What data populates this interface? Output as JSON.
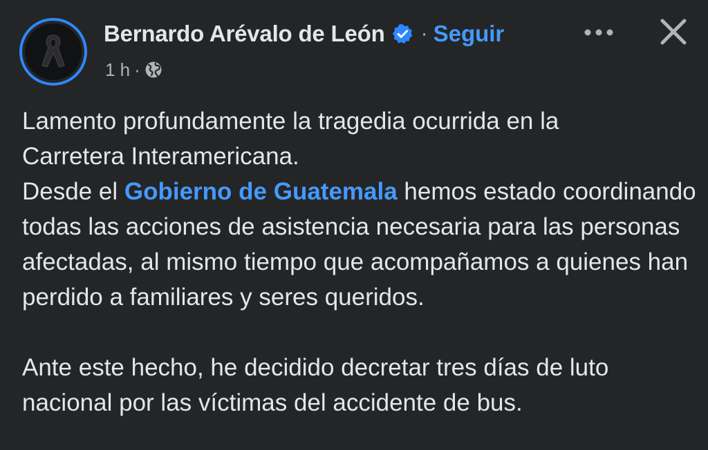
{
  "post": {
    "author_name": "Bernardo Arévalo de León",
    "verified_icon": "verified-badge-icon",
    "separator": "·",
    "follow_label": "Seguir",
    "timestamp": "1 h",
    "audience_icon": "globe-icon",
    "more_icon": "more-options-icon",
    "close_icon": "close-icon",
    "body": {
      "p1_line1": "Lamento profundamente la tragedia ocurrida en la",
      "p1_line2": "Carretera Interamericana.",
      "p2_before": "Desde el ",
      "p2_mention": "Gobierno de Guatemala",
      "p2_after": " hemos estado coordinando todas las acciones de asistencia necesaria para las personas afectadas, al mismo tiempo que acompañamos a quienes han perdido a familiares y seres queridos.",
      "p3": "Ante este hecho, he decidido decretar tres días de luto nacional por las víctimas del accidente de bus."
    }
  },
  "colors": {
    "background": "#242526",
    "primary_text": "#e4e6eb",
    "secondary_text": "#b0b3b8",
    "link": "#4599ff",
    "avatar_ring": "#2d88ff"
  }
}
